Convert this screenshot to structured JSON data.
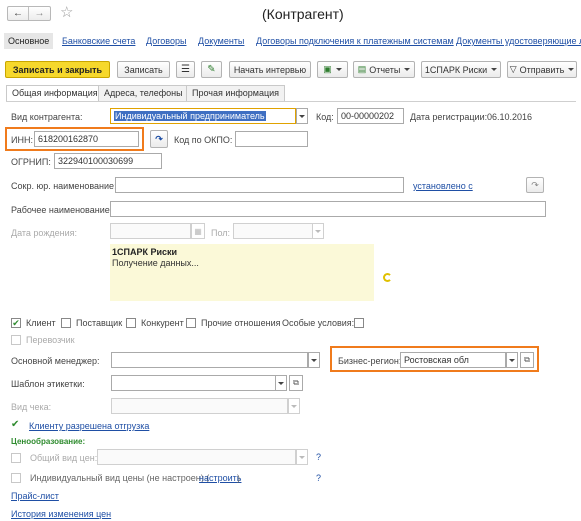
{
  "window": {
    "title": "(Контрагент)"
  },
  "nav": {
    "back": "←",
    "forward": "→",
    "star": "☆",
    "links": [
      "Основное",
      "Банковские счета",
      "Договоры",
      "Документы",
      "Договоры подключения к платежным системам",
      "Документы удостоверяющие ли"
    ]
  },
  "toolbar": {
    "save_close": "Записать и закрыть",
    "save": "Записать",
    "interview": "Начать интервью",
    "reports": "Отчеты",
    "spark": "1СПАРК Риски",
    "send": "Отправить"
  },
  "tabs": [
    "Общая информация",
    "Адреса, телефоны",
    "Прочая информация"
  ],
  "form": {
    "kind_label": "Вид контрагента:",
    "kind_value": "Индивидуальный предприниматель",
    "code_label": "Код:",
    "code_value": "00-00000202",
    "reg_date_label": "Дата регистрации:",
    "reg_date_value": "06.10.2016",
    "inn_label": "ИНН:",
    "inn_value": "618200162870",
    "okpo_label": "Код по ОКПО:",
    "okpo_value": "",
    "ogrnip_label": "ОГРНИП:",
    "ogrnip_value": "322940100030699",
    "short_name_label": "Сокр. юр. наименование:",
    "short_name_value": "",
    "installed_link": "установлено с",
    "work_name_label": "Рабочее наименование:",
    "work_name_value": "",
    "birth_label": "Дата рождения:",
    "gender_label": "Пол:"
  },
  "spark_panel": {
    "title": "1СПАРК Риски",
    "status": "Получение данных..."
  },
  "roles": {
    "client": "Клиент",
    "supplier": "Поставщик",
    "competitor": "Конкурент",
    "other": "Прочие отношения",
    "special": "Особые условия:",
    "carrier": "Перевозчик"
  },
  "manager": {
    "manager_label": "Основной менеджер:",
    "manager_value": "",
    "region_label": "Бизнес-регион:",
    "region_value": "Ростовская обл"
  },
  "label_template": {
    "label": "Шаблон этикетки:",
    "value": ""
  },
  "check_kind": {
    "label": "Вид чека:",
    "value": ""
  },
  "shipment_link": "Клиенту разрешена отгрузка",
  "pricing": {
    "heading": "Ценообразование:",
    "common_label": "Общий вид цен:",
    "individual_label": "Индивидуальный вид цены (не настроен) (",
    "configure_link": "настроить",
    "individual_close": ")",
    "help": "?"
  },
  "bottom_links": {
    "price_list": "Прайс-лист",
    "price_history": "История изменения цен"
  },
  "colors": {
    "accent_orange": "#f07b1c",
    "primary_yellow": "#f6d82c",
    "link_blue": "#1f4fa5",
    "selection_blue": "#3f6fc2",
    "panel_yellow": "#fbf9d8",
    "green_check": "#2e8b2e"
  }
}
